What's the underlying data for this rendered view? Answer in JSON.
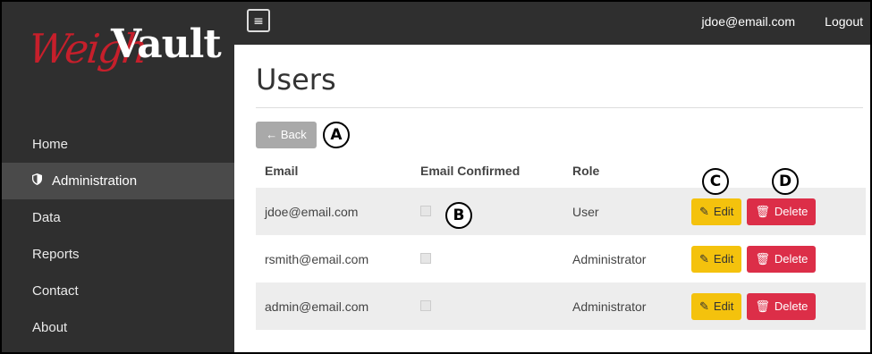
{
  "app": {
    "logo_part1": "Weigh",
    "logo_part2": "Vault"
  },
  "topbar": {
    "menu_icon": "hamburger-icon",
    "user_email": "jdoe@email.com",
    "logout_label": "Logout"
  },
  "sidebar": {
    "items": [
      {
        "label": "Home"
      },
      {
        "label": "Administration",
        "icon": "shield-icon"
      },
      {
        "label": "Data"
      },
      {
        "label": "Reports"
      },
      {
        "label": "Contact"
      },
      {
        "label": "About"
      }
    ]
  },
  "main": {
    "title": "Users",
    "back_label": "← Back",
    "columns": [
      "Email",
      "Email Confirmed",
      "Role"
    ],
    "rows": [
      {
        "email": "jdoe@email.com",
        "confirmed": true,
        "role": "User",
        "edit": "Edit",
        "delete": "Delete"
      },
      {
        "email": "rsmith@email.com",
        "confirmed": true,
        "role": "Administrator",
        "edit": "Edit",
        "delete": "Delete"
      },
      {
        "email": "admin@email.com",
        "confirmed": true,
        "role": "Administrator",
        "edit": "Edit",
        "delete": "Delete"
      }
    ]
  },
  "callouts": {
    "a": "A",
    "b": "B",
    "c": "C",
    "d": "D"
  },
  "colors": {
    "sidebar": "#2f2f2f",
    "edit": "#f4c20d",
    "delete": "#dc2e48",
    "logo_red": "#c61f2b"
  }
}
